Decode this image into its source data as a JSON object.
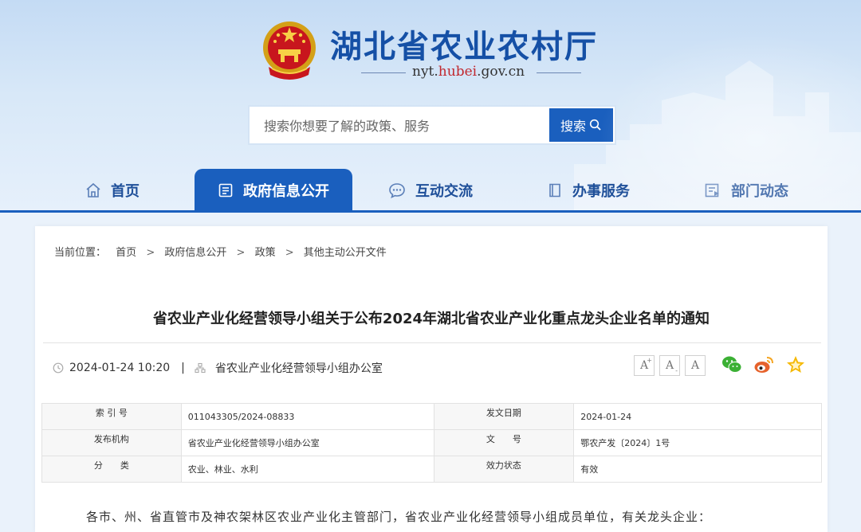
{
  "header": {
    "site_title": "湖北省农业农村厅",
    "url_prefix": "nyt.",
    "url_highlight": "hubei",
    "url_suffix": ".gov.cn",
    "emblem_icon": "national-emblem-icon"
  },
  "search": {
    "placeholder": "搜索你想要了解的政策、服务",
    "button_label": "搜索"
  },
  "nav": {
    "items": [
      {
        "label": "首页",
        "icon": "home-icon"
      },
      {
        "label": "政府信息公开",
        "icon": "document-list-icon",
        "active": true
      },
      {
        "label": "互动交流",
        "icon": "chat-icon"
      },
      {
        "label": "办事服务",
        "icon": "bookmark-icon"
      },
      {
        "label": "部门动态",
        "icon": "news-icon"
      }
    ]
  },
  "breadcrumb": {
    "prefix": "当前位置：",
    "items": [
      "首页",
      "政府信息公开",
      "政策",
      "其他主动公开文件"
    ],
    "separator": ">"
  },
  "article": {
    "title": "省农业产业化经营领导小组关于公布2024年湖北省农业产业化重点龙头企业名单的通知",
    "datetime": "2024-01-24 10:20",
    "meta_separator": "|",
    "publisher": "省农业产业化经营领导小组办公室",
    "font_buttons": [
      "A",
      "A",
      "A"
    ],
    "share_icons": [
      "wechat-icon",
      "weibo-icon",
      "favorite-star-icon"
    ],
    "body_first_line": "各市、州、省直管市及神农架林区农业产业化主管部门，省农业产业化经营领导小组成员单位，有关龙头企业："
  },
  "info_table": {
    "rows": [
      {
        "k1": "索 引 号",
        "v1": "011043305/2024-08833",
        "k2": "发文日期",
        "v2": "2024-01-24"
      },
      {
        "k1": "发布机构",
        "v1": "省农业产业化经营领导小组办公室",
        "k2": "文　　号",
        "v2": "鄂农产发〔2024〕1号"
      },
      {
        "k1": "分　　类",
        "v1": "农业、林业、水利",
        "k2": "效力状态",
        "v2": "有效"
      }
    ]
  },
  "colors": {
    "primary_blue": "#1a5fbe",
    "title_blue": "#1550a6",
    "url_red": "#c1272d",
    "wechat_green": "#3bb034",
    "weibo_orange": "#e6622b",
    "star_yellow": "#f5b800"
  }
}
